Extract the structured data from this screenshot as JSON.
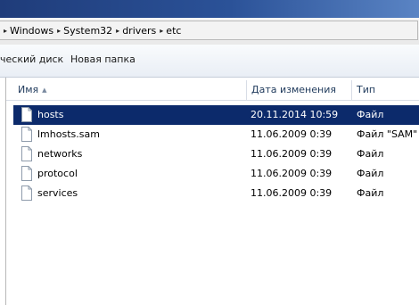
{
  "address": {
    "crumbs": [
      "Windows",
      "System32",
      "drivers",
      "etc"
    ]
  },
  "toolbar": {
    "burn_label": "ческий диск",
    "new_folder_label": "Новая папка"
  },
  "columns": {
    "name": "Имя",
    "date": "Дата изменения",
    "type": "Тип"
  },
  "files": [
    {
      "name": "hosts",
      "date": "20.11.2014 10:59",
      "type": "Файл",
      "selected": true
    },
    {
      "name": "lmhosts.sam",
      "date": "11.06.2009 0:39",
      "type": "Файл \"SAM\"",
      "selected": false
    },
    {
      "name": "networks",
      "date": "11.06.2009 0:39",
      "type": "Файл",
      "selected": false
    },
    {
      "name": "protocol",
      "date": "11.06.2009 0:39",
      "type": "Файл",
      "selected": false
    },
    {
      "name": "services",
      "date": "11.06.2009 0:39",
      "type": "Файл",
      "selected": false
    }
  ],
  "colors": {
    "selection": "#0c2a6b",
    "header_text": "#1e395b"
  },
  "icons": {
    "file": "file-icon",
    "crumb_separator": "chevron-right-icon",
    "sort": "sort-ascending-icon"
  }
}
